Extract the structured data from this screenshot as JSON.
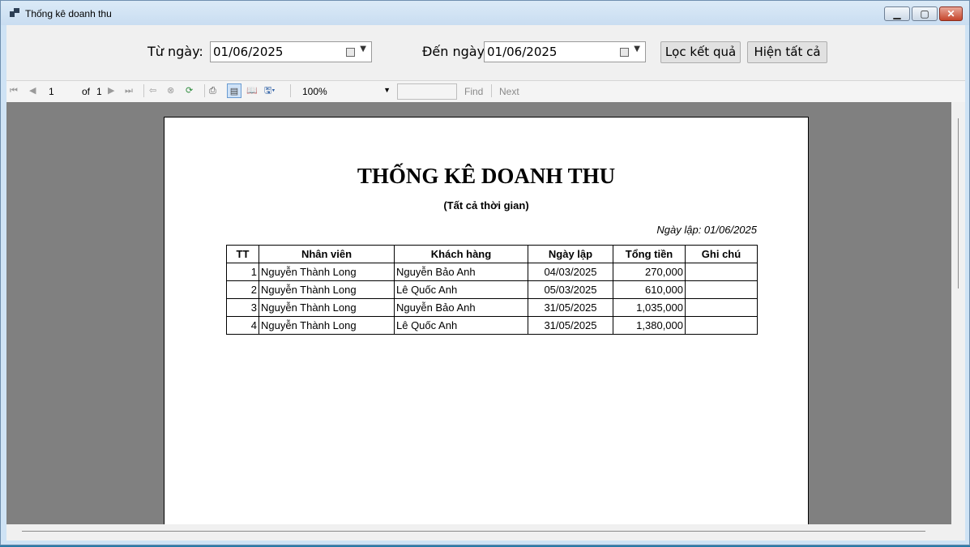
{
  "window": {
    "title": "Thống kê doanh thu"
  },
  "filter": {
    "from_label": "Từ ngày:",
    "from_value": "01/06/2025",
    "to_label": "Đến ngày:",
    "to_value": "01/06/2025",
    "filter_button": "Lọc kết quả",
    "show_all_button": "Hiện tất cả"
  },
  "toolbar": {
    "page_number": "1",
    "page_of": "of",
    "page_total": "1",
    "zoom": "100%",
    "find_text": "",
    "find_label": "Find",
    "next_label": "Next"
  },
  "report": {
    "title": "THỐNG KÊ DOANH THU",
    "subtitle": "(Tất cả thời gian)",
    "created_date": "Ngày lập: 01/06/2025",
    "columns": [
      "TT",
      "Nhân viên",
      "Khách hàng",
      "Ngày lập",
      "Tổng tiền",
      "Ghi chú"
    ],
    "rows": [
      [
        "1",
        "Nguyễn Thành Long",
        "Nguyễn Bảo Anh",
        "04/03/2025",
        "270,000",
        ""
      ],
      [
        "2",
        "Nguyễn Thành Long",
        "Lê Quốc Anh",
        "05/03/2025",
        "610,000",
        ""
      ],
      [
        "3",
        "Nguyễn Thành Long",
        "Nguyễn Bảo Anh",
        "31/05/2025",
        "1,035,000",
        ""
      ],
      [
        "4",
        "Nguyễn Thành Long",
        "Lê Quốc Anh",
        "31/05/2025",
        "1,380,000",
        ""
      ]
    ]
  },
  "icons": [
    "first-page-icon",
    "prev-page-icon",
    "next-page-icon",
    "last-page-icon",
    "back-icon",
    "stop-icon",
    "refresh-icon",
    "print-icon",
    "print-layout-icon",
    "page-setup-icon",
    "export-icon",
    "calendar-icon",
    "dropdown-icon"
  ]
}
